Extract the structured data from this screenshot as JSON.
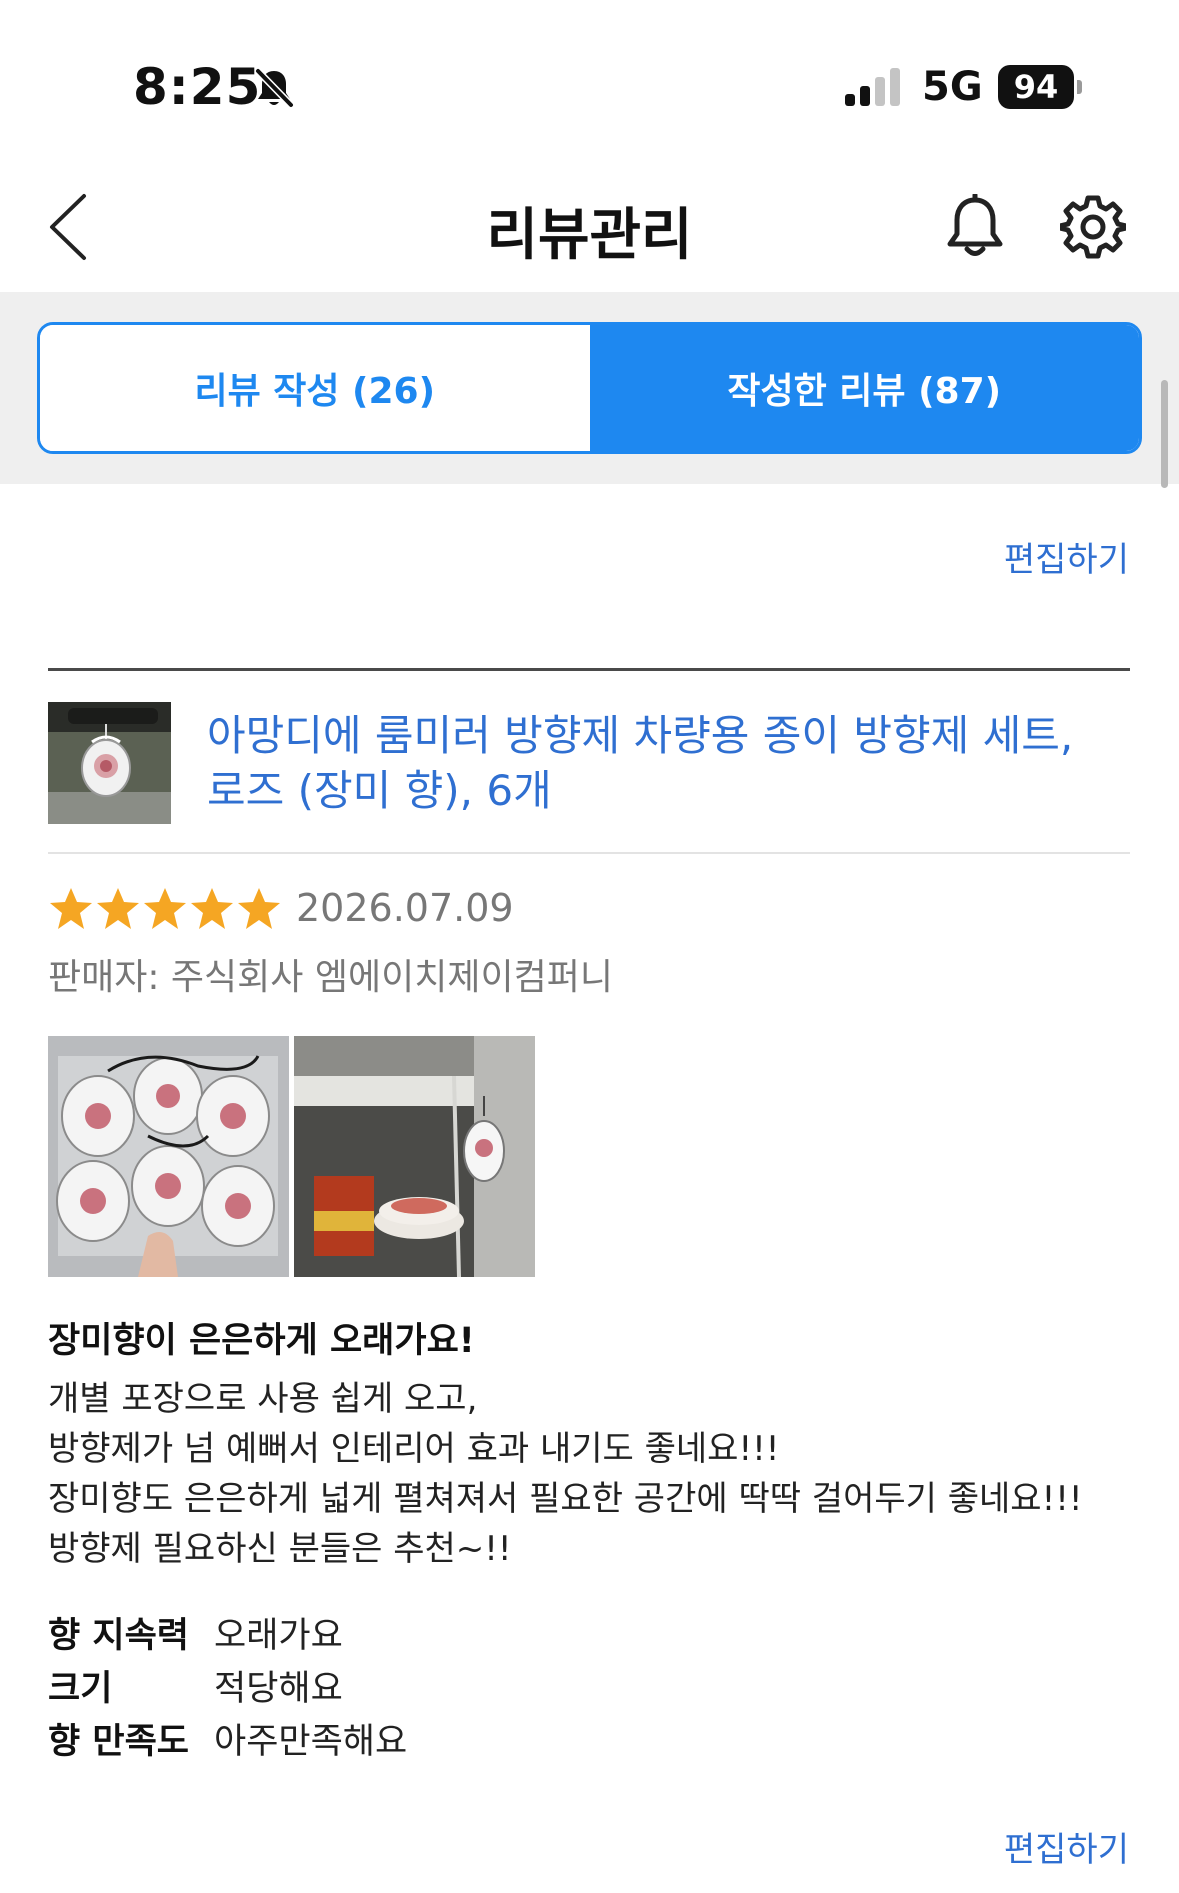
{
  "status_bar": {
    "time": "8:25",
    "network": "5G",
    "battery": "94"
  },
  "header": {
    "title": "리뷰관리"
  },
  "tabs": [
    {
      "label": "리뷰 작성 (26)",
      "active": false
    },
    {
      "label": "작성한 리뷰 (87)",
      "active": true
    }
  ],
  "review": {
    "edit_label_top": "편집하기",
    "product_name": "아망디에 룸미러 방향제 차량용 종이 방향제 세트, 로즈 (장미 향), 6개",
    "rating": 5,
    "date": "2026.07.09",
    "seller": "판매자: 주식회사 엠에이치제이컴퍼니",
    "headline": "장미향이 은은하게 오래가요!",
    "body_lines": [
      "개별 포장으로 사용 쉽게 오고,",
      "방향제가 넘 예뻐서 인테리어 효과 내기도 좋네요!!!",
      "장미향도 은은하게 넓게 펼쳐져서 필요한 공간에 딱딱 걸어두기 좋네요!!!",
      "방향제 필요하신 분들은 추천~!!"
    ],
    "attributes": [
      {
        "label": "향 지속력",
        "value": "오래가요"
      },
      {
        "label": "크기",
        "value": "적당해요"
      },
      {
        "label": "향 만족도",
        "value": "아주만족해요"
      }
    ],
    "edit_label_bottom": "편집하기"
  },
  "colors": {
    "accent": "#1e88f0",
    "link": "#2f6fd1",
    "star": "#f5a623"
  }
}
